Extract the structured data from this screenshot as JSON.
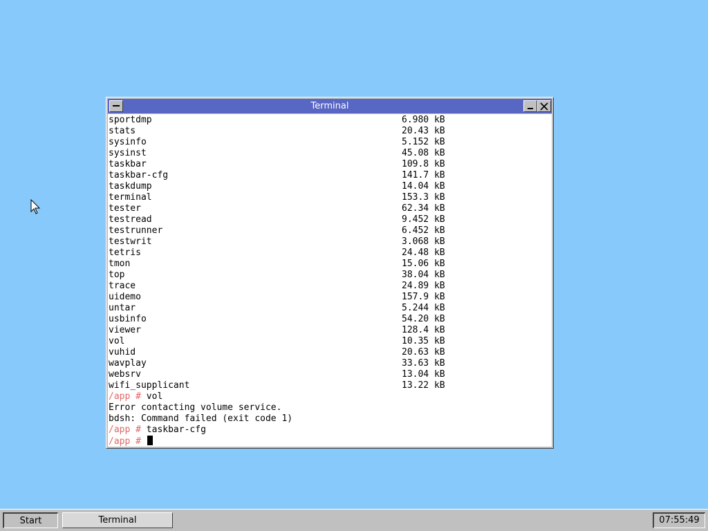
{
  "window": {
    "title": "Terminal"
  },
  "terminal": {
    "files": [
      {
        "name": "sportdmp",
        "size": "6.980 kB"
      },
      {
        "name": "stats",
        "size": "20.43 kB"
      },
      {
        "name": "sysinfo",
        "size": "5.152 kB"
      },
      {
        "name": "sysinst",
        "size": "45.08 kB"
      },
      {
        "name": "taskbar",
        "size": "109.8 kB"
      },
      {
        "name": "taskbar-cfg",
        "size": "141.7 kB"
      },
      {
        "name": "taskdump",
        "size": "14.04 kB"
      },
      {
        "name": "terminal",
        "size": "153.3 kB"
      },
      {
        "name": "tester",
        "size": "62.34 kB"
      },
      {
        "name": "testread",
        "size": "9.452 kB"
      },
      {
        "name": "testrunner",
        "size": "6.452 kB"
      },
      {
        "name": "testwrit",
        "size": "3.068 kB"
      },
      {
        "name": "tetris",
        "size": "24.48 kB"
      },
      {
        "name": "tmon",
        "size": "15.06 kB"
      },
      {
        "name": "top",
        "size": "38.04 kB"
      },
      {
        "name": "trace",
        "size": "24.89 kB"
      },
      {
        "name": "uidemo",
        "size": "157.9 kB"
      },
      {
        "name": "untar",
        "size": "5.244 kB"
      },
      {
        "name": "usbinfo",
        "size": "54.20 kB"
      },
      {
        "name": "viewer",
        "size": "128.4 kB"
      },
      {
        "name": "vol",
        "size": "10.35 kB"
      },
      {
        "name": "vuhid",
        "size": "20.63 kB"
      },
      {
        "name": "wavplay",
        "size": "33.63 kB"
      },
      {
        "name": "websrv",
        "size": "13.04 kB"
      },
      {
        "name": "wifi_supplicant",
        "size": "13.22 kB"
      }
    ],
    "prompt": "/app # ",
    "commands": [
      "vol",
      "taskbar-cfg"
    ],
    "output": [
      "Error contacting volume service.",
      "bdsh: Command failed (exit code 1)"
    ],
    "prompt_color": "#e06666"
  },
  "taskbar": {
    "start_label": "Start",
    "task_label": "Terminal",
    "clock": "07:55:49"
  },
  "colors": {
    "desktop": "#87c9fa",
    "titlebar": "#5866c4"
  },
  "icons": {
    "cursor": "arrow-pointer-icon",
    "system_menu": "system-menu-icon",
    "minimize": "minimize-icon",
    "close": "close-icon"
  }
}
